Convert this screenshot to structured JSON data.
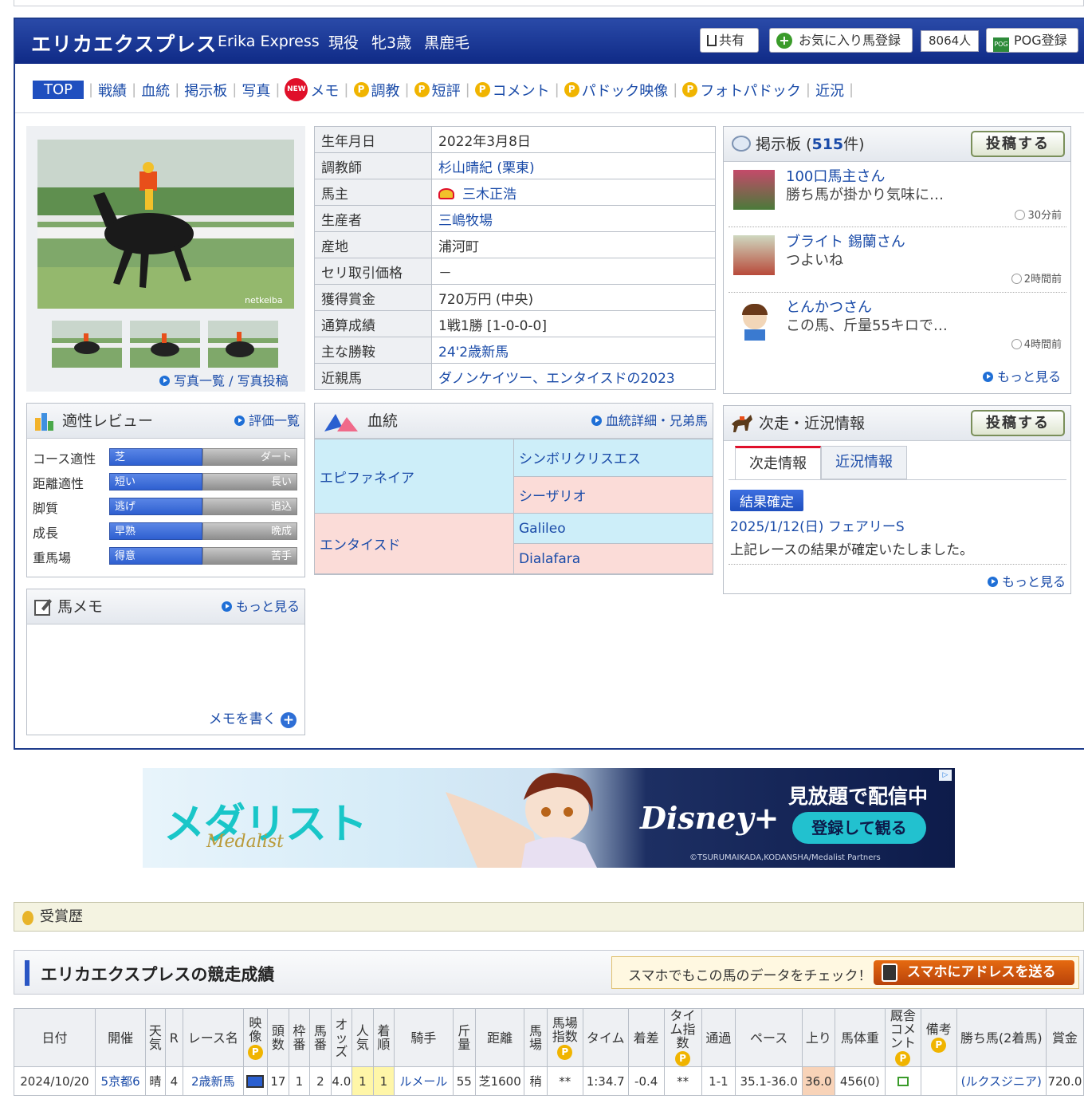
{
  "header": {
    "horse_name": "エリカエクスプレス",
    "horse_name_en": "Erika Express",
    "meta": "現役 牝3歳 黒鹿毛",
    "share_label": "共有",
    "favorite_label": "お気に入り馬登録",
    "favorite_count": "8064人",
    "pog_label": "POG登録"
  },
  "nav": {
    "items": [
      "TOP",
      "戦績",
      "血統",
      "掲示板",
      "写真",
      "メモ",
      "調教",
      "短評",
      "コメント",
      "パドック映像",
      "フォトパドック",
      "近況"
    ]
  },
  "photos": {
    "watermark": "netkeiba",
    "links": "写真一覧 / 写真投稿"
  },
  "profile": {
    "rows": [
      {
        "k": "生年月日",
        "v": "2022年3月8日"
      },
      {
        "k": "調教師",
        "v": "杉山晴紀 (栗東)"
      },
      {
        "k": "馬主",
        "v": "三木正浩"
      },
      {
        "k": "生産者",
        "v": "三嶋牧場"
      },
      {
        "k": "産地",
        "v": "浦河町"
      },
      {
        "k": "セリ取引価格",
        "v": "－"
      },
      {
        "k": "獲得賞金",
        "v": "720万円 (中央)"
      },
      {
        "k": "通算成績",
        "v": "1戦1勝 [1-0-0-0]"
      },
      {
        "k": "主な勝鞍",
        "v": "24'2歳新馬"
      },
      {
        "k": "近親馬",
        "v": "ダノンケイツー、エンタイスドの2023"
      }
    ]
  },
  "board": {
    "title": "掲示板",
    "count": "515",
    "count_suffix": "件)",
    "count_prefix": "(",
    "post_label": "投稿する",
    "posts": [
      {
        "user": "100口馬主さん",
        "text": "勝ち馬が掛かり気味に…",
        "time": "30分前"
      },
      {
        "user": "ブライト 錫蘭さん",
        "text": "つよいね",
        "time": "2時間前"
      },
      {
        "user": "とんかつさん",
        "text": "この馬、斤量55キロで…",
        "time": "4時間前"
      }
    ],
    "more": "もっと見る"
  },
  "review": {
    "title": "適性レビュー",
    "link": "評価一覧",
    "rows": [
      {
        "label": "コース適性",
        "left": "芝",
        "right": "ダート"
      },
      {
        "label": "距離適性",
        "left": "短い",
        "right": "長い"
      },
      {
        "label": "脚質",
        "left": "逃げ",
        "right": "追込"
      },
      {
        "label": "成長",
        "left": "早熟",
        "right": "晩成"
      },
      {
        "label": "重馬場",
        "left": "得意",
        "right": "苦手"
      }
    ]
  },
  "pedigree": {
    "title": "血統",
    "link": "血統詳細・兄弟馬",
    "sire": "エピファネイア",
    "sire_sire": "シンボリクリスエス",
    "sire_dam": "シーザリオ",
    "dam": "エンタイスド",
    "dam_sire": "Galileo",
    "dam_dam": "Dialafara"
  },
  "memo": {
    "title": "馬メモ",
    "more": "もっと見る",
    "write": "メモを書く"
  },
  "next": {
    "title": "次走・近況情報",
    "post_label": "投稿する",
    "tab1": "次走情報",
    "tab2": "近況情報",
    "badge": "結果確定",
    "race": "2025/1/12(日) フェアリーS",
    "note": "上記レースの結果が確定いたしました。",
    "more": "もっと見る"
  },
  "ad": {
    "title_logo": "メダリスト",
    "subtitle_logo": "Medalist",
    "brand": "Disney+",
    "headline": "見放題で配信中",
    "cta": "登録して観る",
    "copyright": "©TSURUMAIKADA,KODANSHA/Medalist Partners"
  },
  "awards": {
    "title": "受賞歴"
  },
  "results": {
    "title": "エリカエクスプレスの競走成績",
    "promo": "スマホでもこの馬のデータをチェック！",
    "send_label": "スマホにアドレスを送る",
    "headers": [
      "日付",
      "開催",
      "天気",
      "R",
      "レース名",
      "映像",
      "頭数",
      "枠番",
      "馬番",
      "オッズ",
      "人気",
      "着順",
      "騎手",
      "斤量",
      "距離",
      "馬場",
      "馬場指数",
      "タイム",
      "着差",
      "タイム指数",
      "通過",
      "ペース",
      "上り",
      "馬体重",
      "厩舎コメント",
      "備考",
      "勝ち馬(2着馬)",
      "賞金"
    ],
    "row": [
      "2024/10/20",
      "5京都6",
      "晴",
      "4",
      "2歳新馬",
      "",
      "17",
      "1",
      "2",
      "4.0",
      "1",
      "1",
      "ルメール",
      "55",
      "芝1600",
      "稍",
      "**",
      "1:34.7",
      "-0.4",
      "**",
      "1-1",
      "35.1-36.0",
      "36.0",
      "456(0)",
      "",
      "",
      "(ルクスジニア)",
      "720.0"
    ]
  },
  "colors": {
    "brand_blue": "#1f3d8c",
    "link": "#1a4ba8",
    "accent_red": "#e0102a"
  },
  "icons": [
    "share-icon",
    "plus-icon",
    "pog-icon",
    "new-badge-icon",
    "p-icon",
    "chat-bubble-icon",
    "clock-icon",
    "chart-icon",
    "pedigree-icon",
    "horse-icon",
    "memo-icon",
    "medal-icon",
    "video-icon",
    "comment-icon"
  ]
}
